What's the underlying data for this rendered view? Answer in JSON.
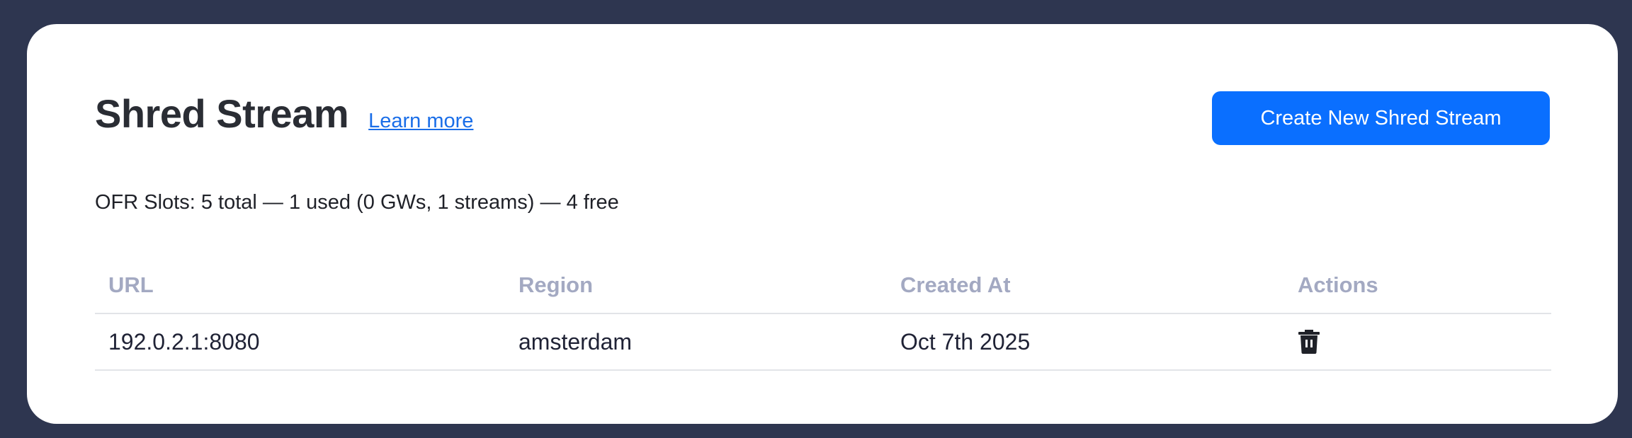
{
  "header": {
    "title": "Shred Stream",
    "learn_more": "Learn more",
    "create_button": "Create New Shred Stream"
  },
  "summary": "OFR Slots: 5 total — 1 used (0 GWs, 1 streams) — 4 free",
  "table": {
    "columns": [
      "URL",
      "Region",
      "Created At",
      "Actions"
    ],
    "rows": [
      {
        "url": "192.0.2.1:8080",
        "region": "amsterdam",
        "created_at": "Oct 7th 2025",
        "actions": [
          "trash-icon"
        ]
      }
    ]
  },
  "colors": {
    "background": "#2e3650",
    "card": "#ffffff",
    "accent": "#0a6fff",
    "link": "#1a6ee8",
    "column_header": "#a3a9c2"
  }
}
